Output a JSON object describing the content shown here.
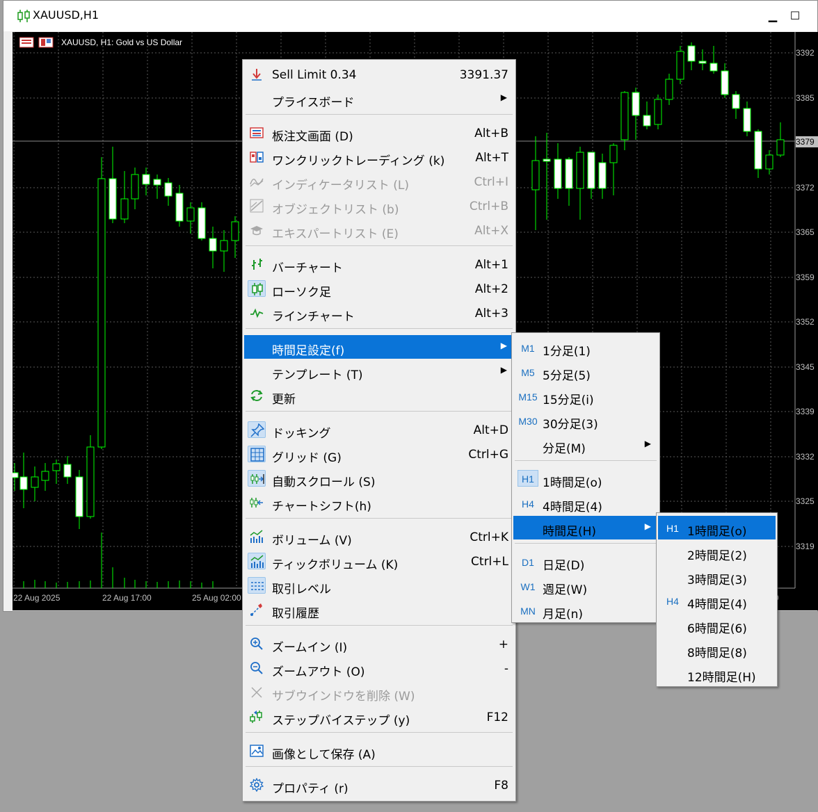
{
  "window": {
    "title": "XAUUSD,H1",
    "minimize_glyph": "▁",
    "maximize_glyph": "☐"
  },
  "chart": {
    "info_label": "XAUUSD, H1:  Gold vs US Dollar",
    "price_labels": [
      "3392",
      "3385",
      "3379",
      "3372",
      "3365",
      "3359",
      "3352",
      "3345",
      "3339",
      "3332",
      "3325",
      "3319"
    ],
    "current_price_label": "3379",
    "time_labels": [
      "22 Aug 2025",
      "22 Aug 17:00",
      "25 Aug 02:00",
      "0"
    ],
    "colors": {
      "background": "#000000",
      "candle": "#00ff00",
      "bull_fill": "#000000",
      "bear_fill": "#ffffff",
      "grid": "#5a5a5a"
    }
  },
  "context_menu": {
    "items": [
      {
        "icon": "sell-limit-icon",
        "label": "Sell Limit 0.34",
        "shortcut": "3391.37"
      },
      {
        "icon": "",
        "label": "プライスボード",
        "submenu": true
      },
      {
        "icon": "order-book-icon",
        "label": "板注文画面 (D)",
        "shortcut": "Alt+B"
      },
      {
        "icon": "one-click-trading-icon",
        "label": "ワンクリックトレーディング (k)",
        "shortcut": "Alt+T"
      },
      {
        "icon": "indicator-list-icon",
        "label": "インディケータリスト (L)",
        "shortcut": "Ctrl+I",
        "disabled": true
      },
      {
        "icon": "object-list-icon",
        "label": "オブジェクトリスト (b)",
        "shortcut": "Ctrl+B",
        "disabled": true
      },
      {
        "icon": "expert-list-icon",
        "label": "エキスパートリスト (E)",
        "shortcut": "Alt+X",
        "disabled": true
      },
      {
        "icon": "bar-chart-icon",
        "label": "バーチャート",
        "shortcut": "Alt+1"
      },
      {
        "icon": "candlestick-icon",
        "label": "ローソク足",
        "shortcut": "Alt+2",
        "checked": true
      },
      {
        "icon": "line-chart-icon",
        "label": "ラインチャート",
        "shortcut": "Alt+3"
      },
      {
        "icon": "",
        "label": "時間足設定(f)",
        "submenu": true,
        "active": true
      },
      {
        "icon": "",
        "label": "テンプレート (T)",
        "submenu": true
      },
      {
        "icon": "refresh-icon",
        "label": "更新"
      },
      {
        "icon": "docking-icon",
        "label": "ドッキング",
        "shortcut": "Alt+D",
        "checked": true
      },
      {
        "icon": "grid-icon",
        "label": "グリッド (G)",
        "shortcut": "Ctrl+G",
        "checked": true
      },
      {
        "icon": "auto-scroll-icon",
        "label": "自動スクロール (S)",
        "checked": true
      },
      {
        "icon": "chart-shift-icon",
        "label": "チャートシフト(h)"
      },
      {
        "icon": "volume-icon",
        "label": "ボリューム (V)",
        "shortcut": "Ctrl+K"
      },
      {
        "icon": "tick-volume-icon",
        "label": "ティックボリューム (K)",
        "shortcut": "Ctrl+L",
        "checked": true
      },
      {
        "icon": "trade-levels-icon",
        "label": "取引レベル",
        "checked": true
      },
      {
        "icon": "trade-history-icon",
        "label": "取引履歴"
      },
      {
        "icon": "zoom-in-icon",
        "label": "ズームイン (I)",
        "shortcut": "+"
      },
      {
        "icon": "zoom-out-icon",
        "label": "ズームアウト (O)",
        "shortcut": "-"
      },
      {
        "icon": "remove-subwindow-icon",
        "label": "サブウインドウを削除 (W)",
        "disabled": true
      },
      {
        "icon": "step-by-step-icon",
        "label": "ステップバイステップ (y)",
        "shortcut": "F12"
      },
      {
        "icon": "save-image-icon",
        "label": "画像として保存 (A)"
      },
      {
        "icon": "properties-icon",
        "label": "プロパティ (r)",
        "shortcut": "F8"
      }
    ]
  },
  "timeframe_menu": {
    "items": [
      {
        "code": "M1",
        "label": "1分足(1)"
      },
      {
        "code": "M5",
        "label": "5分足(5)"
      },
      {
        "code": "M15",
        "label": "15分足(i)"
      },
      {
        "code": "M30",
        "label": "30分足(3)"
      },
      {
        "code": "",
        "label": "分足(M)",
        "submenu": true
      },
      {
        "code": "H1",
        "label": "1時間足(o)",
        "checked": true
      },
      {
        "code": "H4",
        "label": "4時間足(4)"
      },
      {
        "code": "",
        "label": "時間足(H)",
        "submenu": true,
        "active": true
      },
      {
        "code": "D1",
        "label": "日足(D)"
      },
      {
        "code": "W1",
        "label": "週足(W)"
      },
      {
        "code": "MN",
        "label": "月足(n)"
      }
    ]
  },
  "hour_menu": {
    "items": [
      {
        "code": "H1",
        "label": "1時間足(o)",
        "active": true
      },
      {
        "code": "",
        "label": "2時間足(2)"
      },
      {
        "code": "",
        "label": "3時間足(3)"
      },
      {
        "code": "H4",
        "label": "4時間足(4)"
      },
      {
        "code": "",
        "label": "6時間足(6)"
      },
      {
        "code": "",
        "label": "8時間足(8)"
      },
      {
        "code": "",
        "label": "12時間足(H)"
      }
    ]
  }
}
